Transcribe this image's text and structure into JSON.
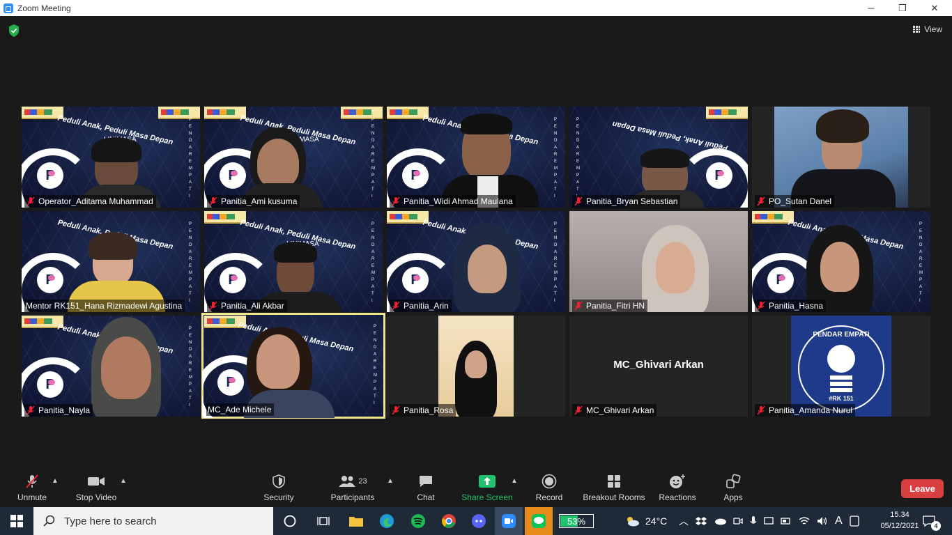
{
  "window": {
    "title": "Zoom Meeting",
    "minimize": "─",
    "restore": "❐",
    "close": "✕"
  },
  "header": {
    "view_label": "View"
  },
  "participants": [
    {
      "name": "Operator_Aditama Muhammad",
      "muted": true
    },
    {
      "name": "Panitia_Ami kusuma",
      "muted": true
    },
    {
      "name": "Panitia_Widi Ahmad Maulana",
      "muted": true
    },
    {
      "name": "Panitia_Bryan Sebastian",
      "muted": true
    },
    {
      "name": "PO_Sutan Danel",
      "muted": true
    },
    {
      "name": "Mentor RK151_Hana Rizmadewi Agustina",
      "muted": false
    },
    {
      "name": "Panitia_Ali Akbar",
      "muted": true
    },
    {
      "name": "Panitia_Arin",
      "muted": true
    },
    {
      "name": "Panitia_Fitri HN",
      "muted": true
    },
    {
      "name": "Panitia_Hasna",
      "muted": true
    },
    {
      "name": "Panitia_Nayla",
      "muted": true
    },
    {
      "name": "MC_Ade Michele",
      "muted": false
    },
    {
      "name": "Panitia_Rosa",
      "muted": true
    },
    {
      "name": "MC_Ghivari Arkan",
      "muted": true
    },
    {
      "name": "Panitia_Amanda Nurul",
      "muted": true
    }
  ],
  "background": {
    "slogan": "Peduli Anak, Peduli Masa Depan",
    "sub": "LINIMASA",
    "vertical": "PENDAREMPATI",
    "logo_letter": "P"
  },
  "namecard": {
    "text": "MC_Ghivari Arkan"
  },
  "avatar_logo": {
    "top": "PENDAR EMPATI",
    "bottom": "#RK 151"
  },
  "toolbar": {
    "unmute": "Unmute",
    "stop_video": "Stop Video",
    "security": "Security",
    "participants": "Participants",
    "participants_count": "23",
    "chat": "Chat",
    "share_screen": "Share Screen",
    "record": "Record",
    "breakout": "Breakout Rooms",
    "reactions": "Reactions",
    "apps": "Apps",
    "leave": "Leave"
  },
  "taskbar": {
    "search_placeholder": "Type here to search",
    "battery": "53%",
    "weather": "24°C",
    "time": "15.34",
    "date": "05/12/2021",
    "notifications": "4",
    "lang": "A"
  }
}
